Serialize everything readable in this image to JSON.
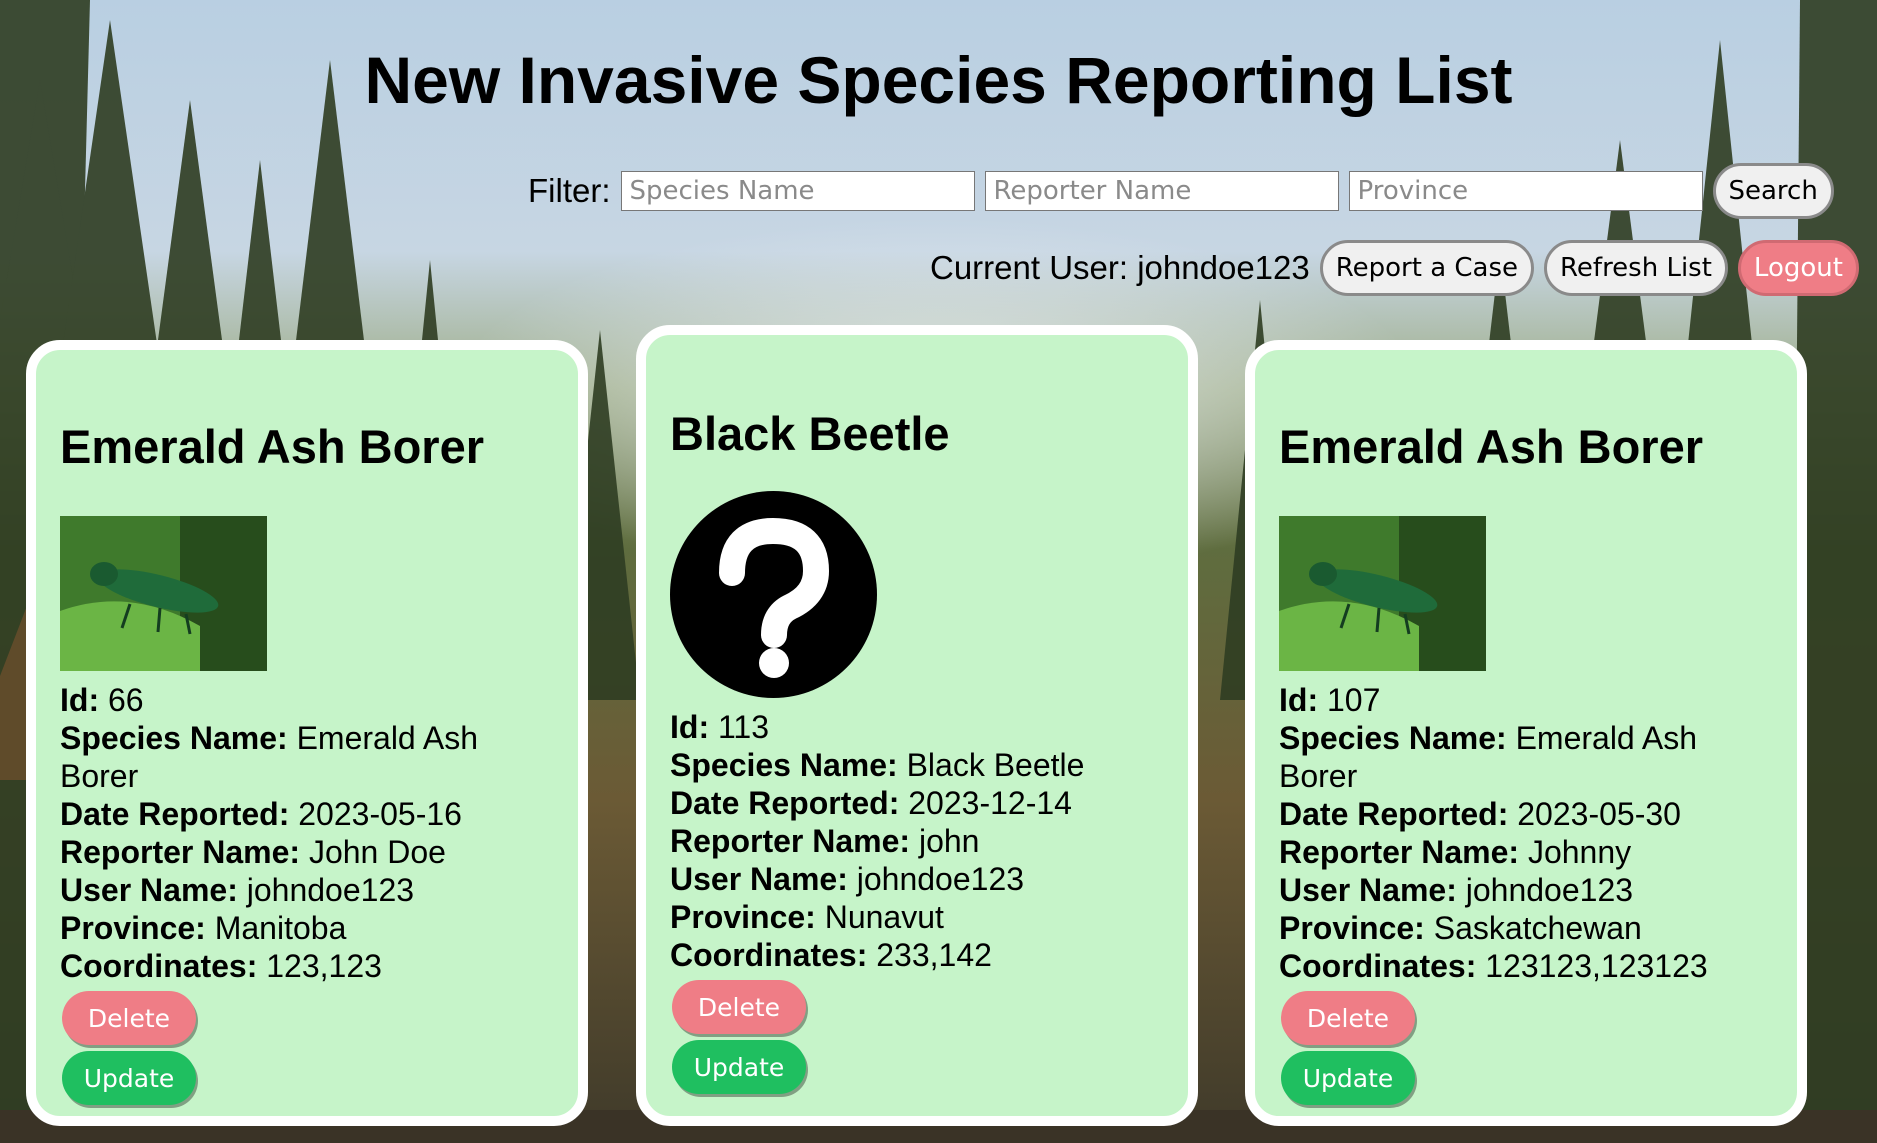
{
  "page": {
    "title": "New Invasive Species Reporting List"
  },
  "filter": {
    "label": "Filter:",
    "species_placeholder": "Species Name",
    "reporter_placeholder": "Reporter Name",
    "province_placeholder": "Province",
    "search_label": "Search"
  },
  "user_bar": {
    "current_user_text": "Current User: johndoe123",
    "report_label": "Report a Case",
    "refresh_label": "Refresh List",
    "logout_label": "Logout"
  },
  "field_labels": {
    "id": "Id:",
    "species": "Species Name:",
    "date": "Date Reported:",
    "reporter": "Reporter Name:",
    "user": "User Name:",
    "province": "Province:",
    "coords": "Coordinates:"
  },
  "buttons": {
    "delete": "Delete",
    "update": "Update"
  },
  "cards": [
    {
      "heading": "Emerald Ash Borer",
      "image": "emerald-ash-borer-photo",
      "id": "66",
      "species": "Emerald Ash Borer",
      "date": "2023-05-16",
      "reporter": "John Doe",
      "user": "johndoe123",
      "province": "Manitoba",
      "coords": "123,123"
    },
    {
      "heading": "Black Beetle",
      "image": "question-mark-icon",
      "id": "113",
      "species": "Black Beetle",
      "date": "2023-12-14",
      "reporter": "john",
      "user": "johndoe123",
      "province": "Nunavut",
      "coords": "233,142"
    },
    {
      "heading": "Emerald Ash Borer",
      "image": "emerald-ash-borer-photo",
      "id": "107",
      "species": "Emerald Ash Borer",
      "date": "2023-05-30",
      "reporter": "Johnny",
      "user": "johndoe123",
      "province": "Saskatchewan",
      "coords": "123123,123123"
    }
  ],
  "colors": {
    "card_bg": "#c6f4c9",
    "delete_btn": "#ef7d86",
    "update_btn": "#1fbf60",
    "logout_btn": "#ef7d86"
  }
}
